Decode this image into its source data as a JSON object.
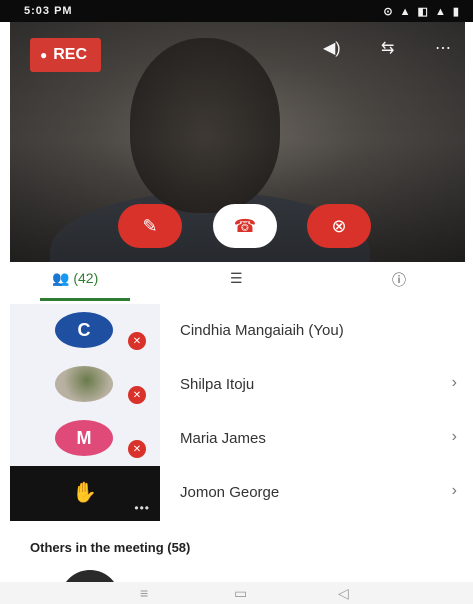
{
  "status_bar": {
    "time": "5:03 PM",
    "icons_text": "⊙ ▲ ◧ ▲ ▮"
  },
  "video": {
    "rec_label": "REC",
    "top_controls": [
      "◀)",
      "⇆",
      "⋯"
    ],
    "controls": {
      "mic_icon": "✎",
      "end_call_icon": "☎",
      "video_off_icon": "⊗"
    }
  },
  "tabs": [
    {
      "label": "(42)",
      "icon": "people-icon",
      "active": true
    },
    {
      "label": "",
      "icon": "chat-icon",
      "active": false
    },
    {
      "label": "",
      "icon": "info-icon",
      "active": false
    }
  ],
  "participants": [
    {
      "name": "Cindhia Mangaiaih (You)",
      "avatar_letter": "C",
      "avatar_color": "#1e4fa1",
      "muted": true,
      "has_chevron": false
    },
    {
      "name": "Shilpa Itoju",
      "avatar_letter": "",
      "avatar_color": "#b8b0a0",
      "muted": true,
      "has_chevron": true
    },
    {
      "name": "Maria James",
      "avatar_letter": "M",
      "avatar_color": "#e04a79",
      "muted": true,
      "has_chevron": true
    },
    {
      "name": "Jomon George",
      "avatar_letter": "",
      "avatar_color": "#121212",
      "muted": false,
      "has_chevron": true
    }
  ],
  "others_section": {
    "label": "Others in the meeting (58)"
  },
  "nav_bar": {
    "left": "≡",
    "middle": "▭",
    "right": "◁"
  },
  "colors": {
    "accent": "#2e7d32",
    "danger": "#d9322a"
  }
}
